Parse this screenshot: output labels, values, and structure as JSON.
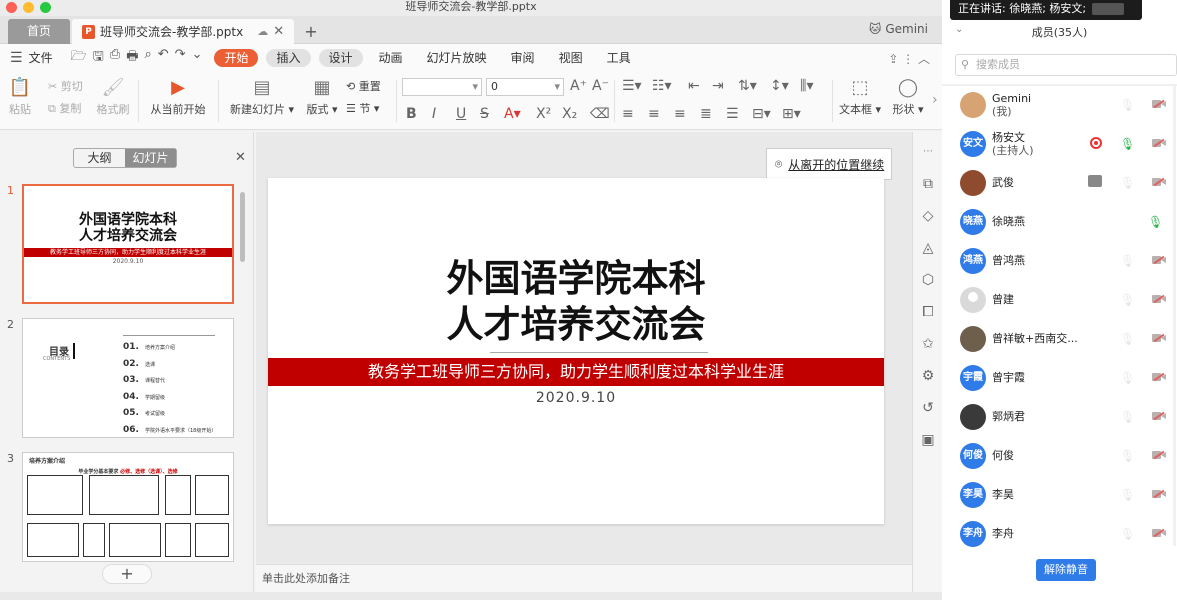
{
  "window": {
    "title": "班导师交流会-教学部.pptx"
  },
  "tabs": {
    "home": "首页",
    "doc": "班导师交流会-教学部.pptx",
    "user": "Gemini"
  },
  "menu": {
    "file": "文件",
    "items": [
      "开始",
      "插入",
      "设计",
      "动画",
      "幻灯片放映",
      "审阅",
      "视图",
      "工具"
    ]
  },
  "ribbon": {
    "paste": "粘贴",
    "cut": "剪切",
    "copy": "复制",
    "format_painter": "格式刷",
    "play_current": "从当前开始",
    "new_slide": "新建幻灯片",
    "layout": "版式",
    "reset": "重置",
    "section": "节",
    "font_size": "0",
    "textbox": "文本框",
    "shape": "形状"
  },
  "left_panel": {
    "tab_outline": "大纲",
    "tab_slides": "幻灯片",
    "slide_numbers": [
      "1",
      "2",
      "3"
    ]
  },
  "thumb1": {
    "title1": "外国语学院本科",
    "title2": "人才培养交流会",
    "banner": "教务学工班导师三方协同，助力学生顺利度过本科学业生涯",
    "date": "2020.9.10"
  },
  "thumb2": {
    "heading": "目录",
    "sub": "CONTENTS",
    "items": [
      {
        "num": "01.",
        "text": "培养方案介绍"
      },
      {
        "num": "02.",
        "text": "选课"
      },
      {
        "num": "03.",
        "text": "课程替代"
      },
      {
        "num": "04.",
        "text": "学期留级"
      },
      {
        "num": "05.",
        "text": "考试留级"
      },
      {
        "num": "06.",
        "text": "学院外语水平要求（18级开始）"
      }
    ]
  },
  "thumb3": {
    "title": "培养方案介绍",
    "sub": "毕业学分基本要求",
    "note": "必修、选修（选课）、选修"
  },
  "slide": {
    "title_line1": "外国语学院本科",
    "title_line2": "人才培养交流会",
    "banner": "教务学工班导师三方协同，助力学生顺利度过本科学业生涯",
    "date": "2020.9.10",
    "accent": "#c00000"
  },
  "resume_popup": "从离开的位置继续",
  "notes_placeholder": "单击此处添加备注",
  "meeting": {
    "speaking": "正在讲话: 徐晓燕; 杨安文;",
    "members_label": "成员(35人)",
    "search_placeholder": "搜索成员",
    "unmute_all": "解除静音",
    "members": [
      {
        "initials": "",
        "name": "Gemini",
        "sub": "(我)",
        "avatar": "img",
        "mic": "muted",
        "cam": "off"
      },
      {
        "initials": "安文",
        "name": "杨安文",
        "sub": "(主持人)",
        "avatar": "blue",
        "mic": "on",
        "cam": "off",
        "recording": true
      },
      {
        "initials": "",
        "name": "武俊",
        "sub": "",
        "avatar": "img",
        "mic": "muted",
        "cam": "off",
        "sharing": true
      },
      {
        "initials": "晓燕",
        "name": "徐晓燕",
        "sub": "",
        "avatar": "blue",
        "mic": "on",
        "cam": "none"
      },
      {
        "initials": "鸿燕",
        "name": "曾鸿燕",
        "sub": "",
        "avatar": "blue",
        "mic": "muted",
        "cam": "off"
      },
      {
        "initials": "",
        "name": "曾建",
        "sub": "",
        "avatar": "grey",
        "mic": "muted",
        "cam": "off"
      },
      {
        "initials": "",
        "name": "曾祥敏+西南交...",
        "sub": "",
        "avatar": "img",
        "mic": "muted",
        "cam": "off"
      },
      {
        "initials": "宇霞",
        "name": "曾宇霞",
        "sub": "",
        "avatar": "blue",
        "mic": "muted",
        "cam": "off"
      },
      {
        "initials": "",
        "name": "郭炳君",
        "sub": "",
        "avatar": "img",
        "mic": "muted",
        "cam": "off"
      },
      {
        "initials": "何俊",
        "name": "何俊",
        "sub": "",
        "avatar": "blue",
        "mic": "muted",
        "cam": "off"
      },
      {
        "initials": "李昊",
        "name": "李昊",
        "sub": "",
        "avatar": "blue",
        "mic": "muted",
        "cam": "off"
      },
      {
        "initials": "李舟",
        "name": "李舟",
        "sub": "",
        "avatar": "blue",
        "mic": "muted",
        "cam": "off"
      }
    ]
  },
  "colors": {
    "accent": "#ec5e34",
    "blue": "#2f7be8",
    "red_band": "#c00000"
  }
}
